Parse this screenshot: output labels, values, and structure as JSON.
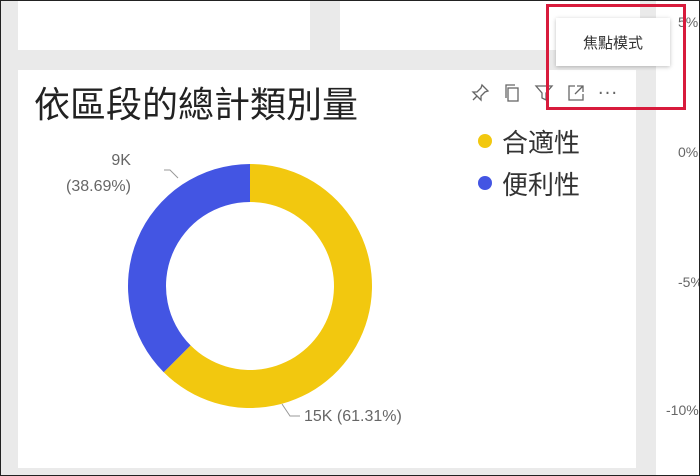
{
  "visual": {
    "title": "依區段的總計類別量",
    "tooltip": "焦點模式",
    "toolbar": {
      "icons": [
        "pin-icon",
        "copy-icon",
        "filter-icon",
        "focus-mode-icon",
        "more-options-icon"
      ],
      "more_glyph": "···"
    }
  },
  "right_axis": {
    "labels": [
      "5%",
      "0%",
      "-5%",
      "-10%"
    ]
  },
  "chart_data": {
    "type": "pie",
    "subtype": "donut",
    "categories": [
      "合適性",
      "便利性"
    ],
    "values": [
      15000,
      9000
    ],
    "percentages": [
      61.31,
      38.69
    ],
    "data_labels": [
      "15K (61.31%)",
      "9K\n(38.69%)"
    ],
    "colors": [
      "#f2c80f",
      "#4355e3"
    ],
    "legend": {
      "entries": [
        "合適性",
        "便利性"
      ],
      "placement": "top-right"
    }
  }
}
